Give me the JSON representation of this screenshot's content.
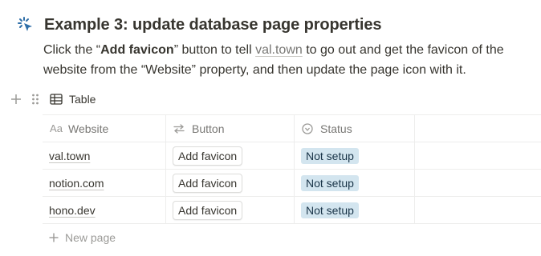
{
  "heading": {
    "icon": "sparkle-cursor-icon",
    "title": "Example 3: update database page properties"
  },
  "paragraph": {
    "part1": "Click the “",
    "bold": "Add favicon",
    "part2": "” button to tell ",
    "link": "val.town",
    "part3": " to go out and get the favicon of the website from the “Website” property, and then update the page icon with it."
  },
  "view": {
    "title": "Table",
    "icon": "table-icon"
  },
  "table": {
    "columns": [
      {
        "label": "Website",
        "icon": "text-aa-icon"
      },
      {
        "label": "Button",
        "icon": "arrows-swap-icon"
      },
      {
        "label": "Status",
        "icon": "status-circle-icon"
      }
    ],
    "rows": [
      {
        "website": "val.town",
        "button": "Add favicon",
        "status": "Not setup"
      },
      {
        "website": "notion.com",
        "button": "Add favicon",
        "status": "Not setup"
      },
      {
        "website": "hono.dev",
        "button": "Add favicon",
        "status": "Not setup"
      }
    ],
    "new_page_label": "New page"
  },
  "colors": {
    "text": "#37352f",
    "muted": "#787774",
    "status_bg": "#d3e5ef",
    "status_text": "#183347",
    "heading_icon": "#2f6fa8"
  }
}
